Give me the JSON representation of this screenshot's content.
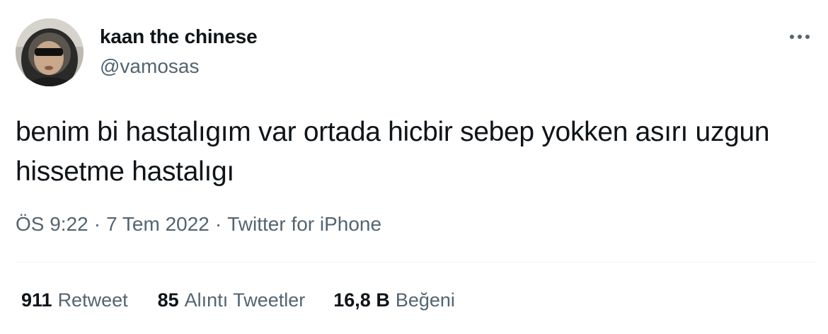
{
  "user": {
    "display_name": "kaan the chinese",
    "handle": "@vamosas"
  },
  "tweet": {
    "text": "benim bi hastalıgım var ortada hicbir sebep yokken asırı uzgun hissetme hastalıgı",
    "time": "ÖS 9:22",
    "date": "7 Tem 2022",
    "source": "Twitter for iPhone",
    "separator": "·"
  },
  "stats": {
    "retweets": {
      "count": "911",
      "label": "Retweet"
    },
    "quotes": {
      "count": "85",
      "label": "Alıntı Tweetler"
    },
    "likes": {
      "count": "16,8 B",
      "label": "Beğeni"
    }
  },
  "icons": {
    "more": "more-horizontal-icon"
  },
  "colors": {
    "primary_text": "#0f1419",
    "secondary_text": "#536471",
    "divider": "#eff3f4"
  }
}
